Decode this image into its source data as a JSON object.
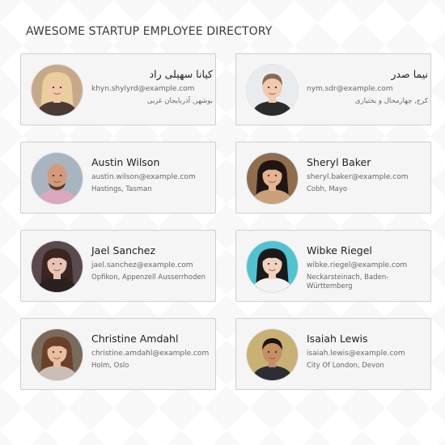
{
  "page": {
    "title": "AWESOME STARTUP EMPLOYEE DIRECTORY"
  },
  "employees": [
    {
      "name": "کیانا سهیلی راد",
      "email": "khyn.shylyrd@example.com",
      "location": "بوشهر, آذربایجان غربی",
      "avatar": {
        "bg": "#c7a98a",
        "skin": "#f0c9a8",
        "hair": "#e9cf9c",
        "shirt": "#4a3a35",
        "style": "long"
      }
    },
    {
      "name": "نیما صدر",
      "email": "nym.sdr@example.com",
      "location": "کرج, چهارمحال و بختیاری",
      "avatar": {
        "bg": "#e9ecef",
        "skin": "#f2c8ae",
        "hair": "#8a6a52",
        "shirt": "#2b2b2b",
        "style": "short"
      }
    },
    {
      "name": "Austin Wilson",
      "email": "austin.wilson@example.com",
      "location": "Hastings, Tasman",
      "avatar": {
        "bg": "#a8b4c0",
        "skin": "#d49a7a",
        "hair": "#5a3b2a",
        "shirt": "#d9a8c0",
        "style": "bald"
      }
    },
    {
      "name": "Sheryl Baker",
      "email": "sheryl.baker@example.com",
      "location": "Cobh, Mayo",
      "avatar": {
        "bg": "#8f6d4d",
        "skin": "#e3b48f",
        "hair": "#1e1612",
        "shirt": "#c9a07a",
        "style": "long"
      }
    },
    {
      "name": "Jael Sanchez",
      "email": "jael.sanchez@example.com",
      "location": "Opfikon, Appenzell Ausserrhoden",
      "avatar": {
        "bg": "#5a4a4e",
        "skin": "#e8c4b0",
        "hair": "#3a2520",
        "shirt": "#2a2022",
        "style": "long"
      }
    },
    {
      "name": "Wibke Riegel",
      "email": "wibke.riegel@example.com",
      "location": "Neckarsteinach, Baden-Württemberg",
      "avatar": {
        "bg": "#4fc3cf",
        "skin": "#f0d2bd",
        "hair": "#1a1a1a",
        "shirt": "#f2f2f2",
        "style": "long"
      }
    },
    {
      "name": "Christine Amdahl",
      "email": "christine.amdahl@example.com",
      "location": "Holm, Oslo",
      "avatar": {
        "bg": "#7a6a5a",
        "skin": "#e7bfa0",
        "hair": "#6a4028",
        "shirt": "#c8c0b8",
        "style": "long"
      }
    },
    {
      "name": "Isaiah Lewis",
      "email": "isaiah.lewis@example.com",
      "location": "City Of London, Devon",
      "avatar": {
        "bg": "#c9b074",
        "skin": "#c48f62",
        "hair": "#1a1410",
        "shirt": "#2d2d36",
        "style": "short"
      }
    }
  ]
}
